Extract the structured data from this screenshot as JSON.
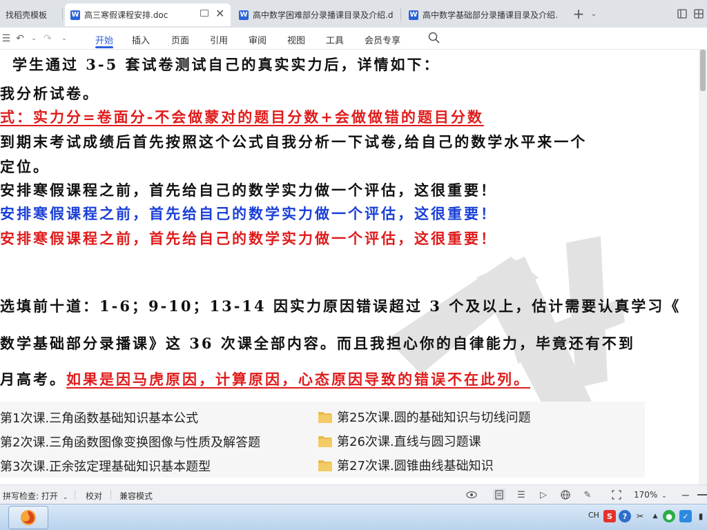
{
  "tabs": [
    {
      "label": "找稻壳模板",
      "active": false
    },
    {
      "label": "高三寒假课程安排.doc",
      "active": true
    },
    {
      "label": "高中数学困难部分录播课目录及介绍.d",
      "active": false
    },
    {
      "label": "高中数学基础部分录播课目录及介绍.",
      "active": false
    }
  ],
  "ribbon": {
    "menu": [
      "开始",
      "插入",
      "页面",
      "引用",
      "审阅",
      "视图",
      "工具",
      "会员专享"
    ],
    "active_menu": "开始"
  },
  "document": {
    "lines": {
      "l1": "学生通过 3-5 套试卷测试自己的真实实力后，详情如下：",
      "l2": "我分析试卷。",
      "l3": "式：实力分=卷面分-不会做蒙对的题目分数+会做做错的题目分数",
      "l4": "到期末考试成绩后首先按照这个公式自我分析一下试卷,给自己的数学水平来一个",
      "l5": "定位。",
      "l6": "安排寒假课程之前，首先给自己的数学实力做一个评估，这很重要！",
      "l7": "安排寒假课程之前，首先给自己的数学实力做一个评估，这很重要！",
      "l8": "安排寒假课程之前，首先给自己的数学实力做一个评估，这很重要！",
      "l9": "选填前十道：1-6；9-10；13-14 因实力原因错误超过 3 个及以上，估计需要认真学习《",
      "l10": "数学基础部分录播课》这 36 次课全部内容。而且我担心你的自律能力，毕竟还有不到",
      "l11a": "月高考。",
      "l11b": "如果是因马虎原因，计算原因，心态原因导致的错误不在此列。"
    },
    "files_left": [
      "第1次课.三角函数基础知识基本公式",
      "第2次课.三角函数图像变换图像与性质及解答题",
      "第3次课.正余弦定理基础知识基本题型"
    ],
    "files_right": [
      "第25次课.圆的基础知识与切线问题",
      "第26次课.直线与圆习题课",
      "第27次课.圆锥曲线基础知识"
    ]
  },
  "statusbar": {
    "spellcheck": "拼写检查: 打开",
    "proofread": "校对",
    "compat_mode": "兼容模式",
    "zoom": "170%"
  },
  "taskbar": {
    "lang": "CH"
  },
  "colors": {
    "accent": "#2b5fd9",
    "red_text": "#e01b1b",
    "blue_text": "#1a3fd6",
    "folder": "#e9b949"
  }
}
